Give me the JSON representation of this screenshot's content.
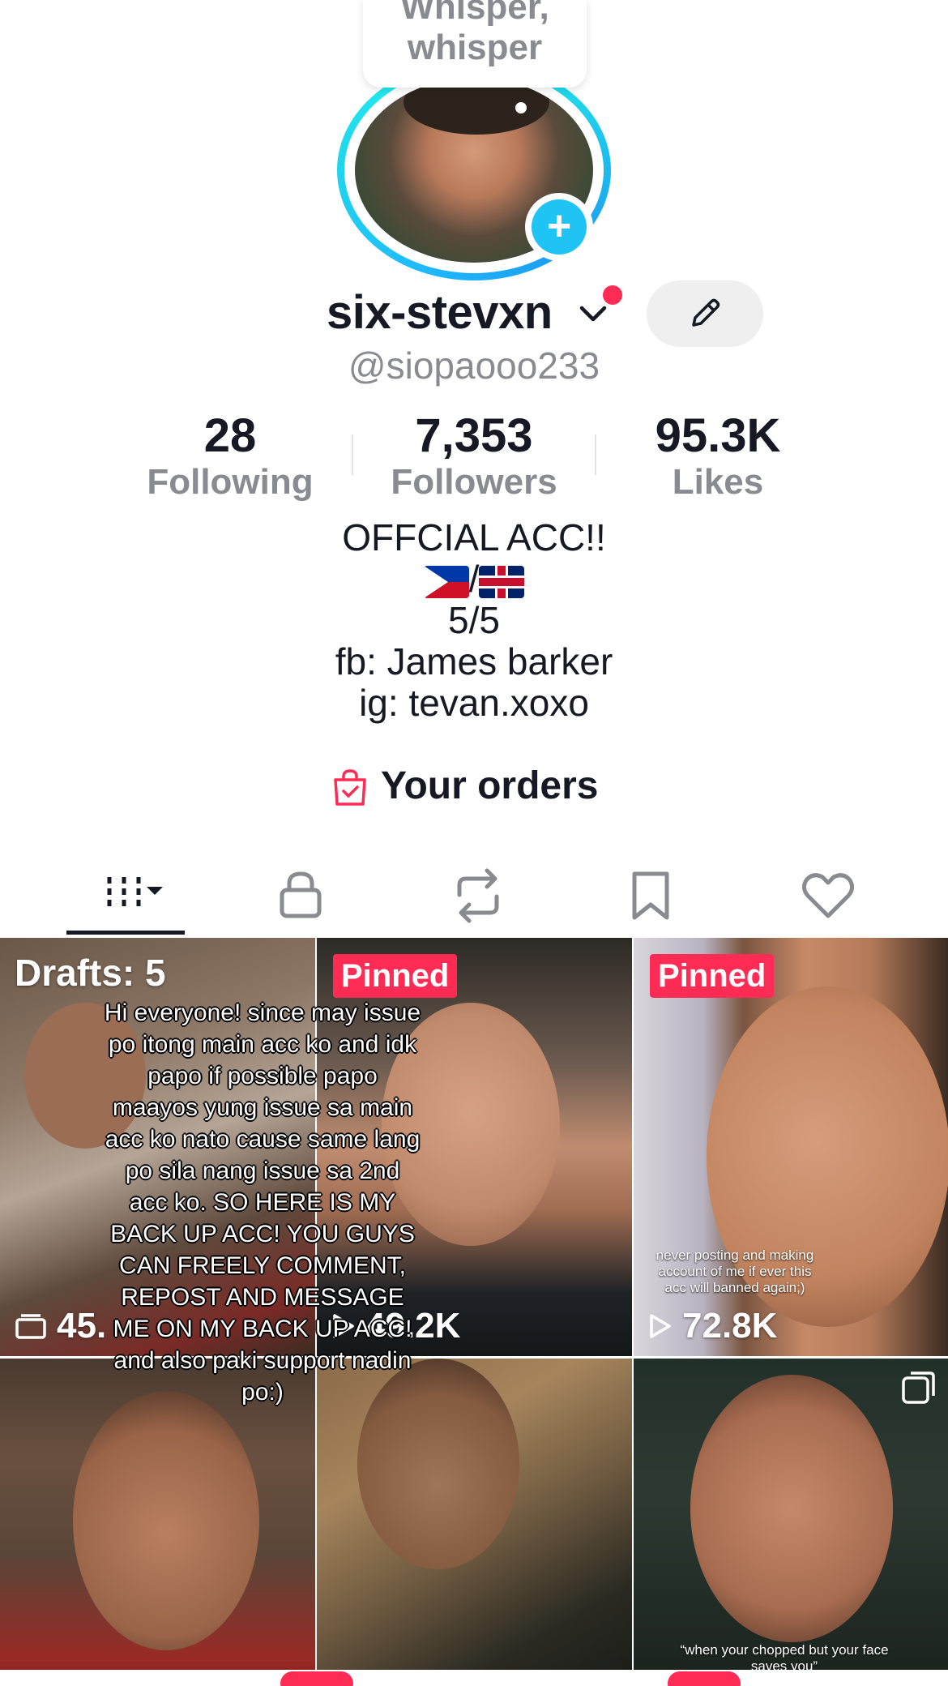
{
  "bubble": {
    "line1": "Whisper,",
    "line2": "whisper"
  },
  "profile": {
    "display_name": "six-stevxn",
    "handle": "@siopaooo233"
  },
  "stats": [
    {
      "value": "28",
      "label": "Following"
    },
    {
      "value": "7,353",
      "label": "Followers"
    },
    {
      "value": "95.3K",
      "label": "Likes"
    }
  ],
  "bio": {
    "line1": "OFFCIAL ACC!!",
    "flag_separator": "/",
    "line3": "5/5",
    "line4": "fb: James barker",
    "line5": "ig: tevan.xoxo"
  },
  "orders": {
    "label": "Your orders"
  },
  "tabs": [
    "videos-icon",
    "lock-icon",
    "repost-icon",
    "bookmark-icon",
    "heart-icon"
  ],
  "grid": {
    "drafts_label": "Drafts: 5",
    "drafts_views": "45.",
    "pinned_label": "Pinned",
    "video2_views": "49.2K",
    "video3_views": "72.8K",
    "video3_caption": "never posting and making account of me if ever this acc will banned again;)",
    "overlay_text": "Hi everyone! since may issue po itong main acc ko and idk papo if possible papo maayos yung issue sa main acc ko nato cause same lang po sila nang issue sa 2nd acc ko. SO HERE IS MY BACK UP ACC! YOU GUYS CAN FREELY COMMENT, REPOST AND MESSAGE ME ON MY BACK UP ACC! and also paki support nadin po:)",
    "video6_caption": "“when your chopped but your face saves you”"
  },
  "colors": {
    "accent": "#fe2c55",
    "ring": "#20d5ec",
    "add_button": "#20c4f4",
    "secondary_text": "#8a8b91"
  }
}
